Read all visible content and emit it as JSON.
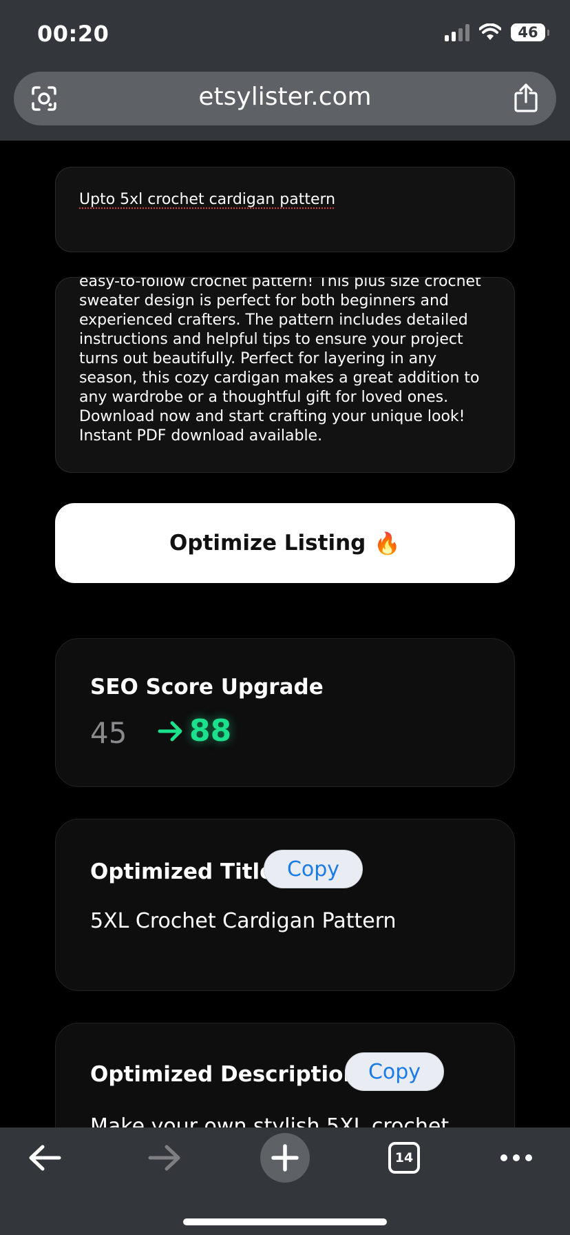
{
  "status_bar": {
    "time": "00:20",
    "battery": "46"
  },
  "browser": {
    "url": "etsylister.com",
    "tab_count": "14",
    "icons": {
      "lens": "camera-lens-icon",
      "share": "share-icon",
      "back": "back-arrow-icon",
      "forward": "forward-arrow-icon",
      "new_tab": "plus-icon",
      "tabs": "tabs-icon",
      "more": "more-dots-icon"
    }
  },
  "form": {
    "title_input_value": "Upto 5xl crochet cardigan pattern",
    "description_input_value": "easy-to-follow crochet pattern! This plus size crochet sweater design is perfect for both beginners and experienced crafters. The pattern includes detailed instructions and helpful tips to ensure your project turns out beautifully. Perfect for layering in any season, this cozy cardigan makes a great addition to any wardrobe or a thoughtful gift for loved ones. Download now and start crafting your unique look! Instant PDF download available.",
    "optimize_button_label": "Optimize Listing",
    "optimize_button_emoji": "🔥"
  },
  "seo": {
    "heading": "SEO Score Upgrade",
    "old_score": "45",
    "new_score": "88",
    "accent_color": "#1be08c"
  },
  "optimized_title": {
    "heading": "Optimized Title",
    "copy_label": "Copy",
    "value": "5XL Crochet Cardigan Pattern"
  },
  "optimized_description": {
    "heading": "Optimized Description",
    "copy_label": "Copy",
    "value": "Make your own stylish 5XL crochet"
  }
}
